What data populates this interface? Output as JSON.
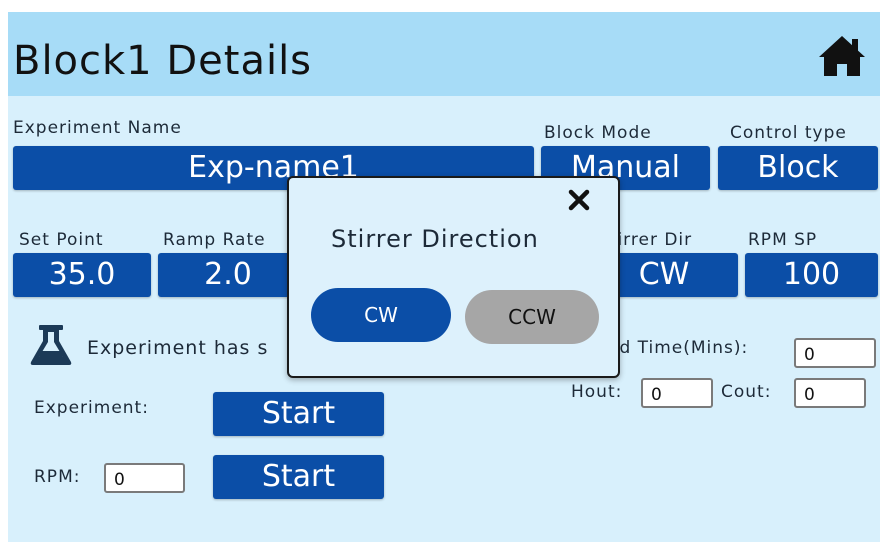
{
  "header": {
    "title": "Block1 Details",
    "home_icon": "home-icon"
  },
  "form": {
    "experiment_name_label": "Experiment Name",
    "experiment_name_value": "Exp-name1",
    "block_mode_label": "Block Mode",
    "block_mode_value": "Manual",
    "control_type_label": "Control type",
    "control_type_value": "Block",
    "set_point_label": "Set Point",
    "set_point_value": "35.0",
    "ramp_rate_label": "Ramp Rate",
    "ramp_rate_value": "2.0",
    "stirrer_dir_label": "Stirrer Dir",
    "stirrer_dir_value": "CW",
    "rpm_sp_label": "RPM SP",
    "rpm_sp_value": "100",
    "status_text": "Experiment has s",
    "elapsed_label": "ed Time(Mins):",
    "elapsed_value": "0",
    "hout_label": "Hout:",
    "hout_value": "0",
    "cout_label": "Cout:",
    "cout_value": "0",
    "experiment_label": "Experiment:",
    "experiment_button": "Start",
    "rpm_label": "RPM:",
    "rpm_value": "0",
    "rpm_button": "Start"
  },
  "modal": {
    "title": "Stirrer Direction",
    "close_icon": "close-icon",
    "cw_label": "CW",
    "ccw_label": "CCW"
  },
  "colors": {
    "field_blue": "#0b4ea7",
    "header_bg": "#a7dcf7",
    "page_bg": "#d8f0fc",
    "ccw_grey": "#a6a6a6"
  }
}
